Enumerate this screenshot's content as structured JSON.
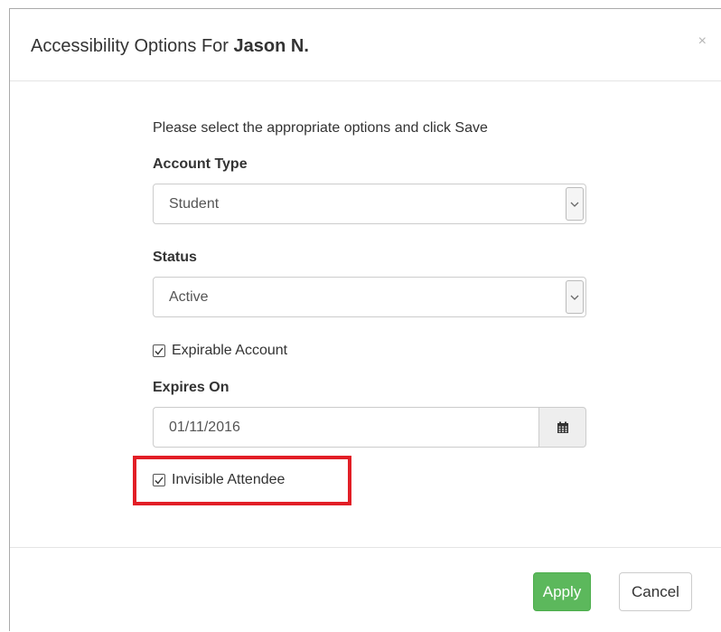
{
  "dialog": {
    "title_prefix": "Accessibility Options For",
    "title_name": "Jason N.",
    "close_glyph": "×"
  },
  "form": {
    "instructions": "Please select the appropriate options and click Save",
    "account_type": {
      "label": "Account Type",
      "value": "Student"
    },
    "status": {
      "label": "Status",
      "value": "Active"
    },
    "expirable": {
      "label": "Expirable Account",
      "checked": true
    },
    "expires_on": {
      "label": "Expires On",
      "value": "01/11/2016"
    },
    "invisible": {
      "label": "Invisible Attendee",
      "checked": true
    }
  },
  "footer": {
    "apply_label": "Apply",
    "cancel_label": "Cancel"
  },
  "colors": {
    "apply_bg": "#5cb85c",
    "highlight": "#e21e26"
  },
  "icons": [
    "close-icon",
    "chevron-down-icon",
    "calendar-icon",
    "checkmark-icon"
  ]
}
